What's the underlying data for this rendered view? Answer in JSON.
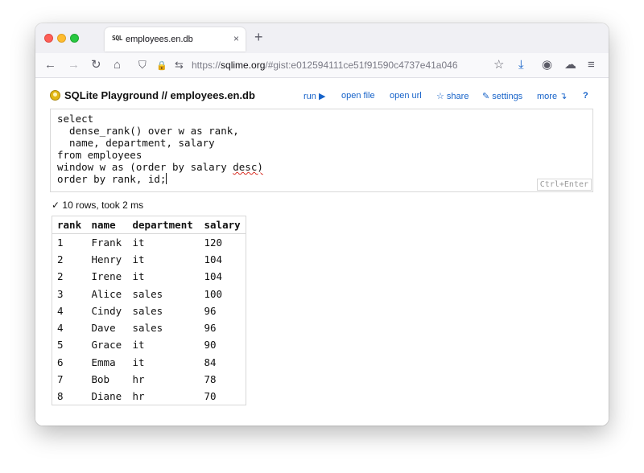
{
  "browser": {
    "tab_favicon": "SQL",
    "tab_title": "employees.en.db",
    "tab_close": "×",
    "new_tab": "+",
    "url_scheme": "https://",
    "url_host": "sqlime.org",
    "url_path": "/#gist:e012594111ce51f91590c4737e41a046",
    "icons": [
      "back-icon",
      "forward-icon",
      "reload-icon",
      "home-icon",
      "shield-icon",
      "lock-icon",
      "permissions-icon",
      "bookmark-star-icon",
      "download-icon",
      "account-icon",
      "cloud-icon",
      "menu-icon"
    ],
    "glyphs": {
      "back": "←",
      "forward": "→",
      "reload": "↻",
      "home": "⌂",
      "shield": "⛉",
      "lock": "🔒",
      "permissions": "⇆",
      "star": "☆",
      "download": "⤓",
      "account": "◉",
      "cloud": "☁",
      "menu": "≡"
    }
  },
  "app": {
    "title": "SQLite Playground // employees.en.db",
    "menu": {
      "run": "run ▶",
      "open_file": "open file",
      "open_url": "open url",
      "share": "☆ share",
      "settings": "✎ settings",
      "more": "more ↴",
      "help": "?"
    }
  },
  "editor": {
    "lines": [
      "select",
      "  dense_rank() over w as rank,",
      "  name, department, salary",
      "from employees",
      "window w as (order by salary ",
      "order by rank, id;"
    ],
    "squiggle_word": "desc)",
    "hint": "Ctrl+Enter"
  },
  "status": "✓ 10 rows, took 2 ms",
  "results": {
    "columns": [
      "rank",
      "name",
      "department",
      "salary"
    ],
    "rows": [
      [
        "1",
        "Frank",
        "it",
        "120"
      ],
      [
        "2",
        "Henry",
        "it",
        "104"
      ],
      [
        "2",
        "Irene",
        "it",
        "104"
      ],
      [
        "3",
        "Alice",
        "sales",
        "100"
      ],
      [
        "4",
        "Cindy",
        "sales",
        "96"
      ],
      [
        "4",
        "Dave",
        "sales",
        "96"
      ],
      [
        "5",
        "Grace",
        "it",
        "90"
      ],
      [
        "6",
        "Emma",
        "it",
        "84"
      ],
      [
        "7",
        "Bob",
        "hr",
        "78"
      ],
      [
        "8",
        "Diane",
        "hr",
        "70"
      ]
    ]
  }
}
